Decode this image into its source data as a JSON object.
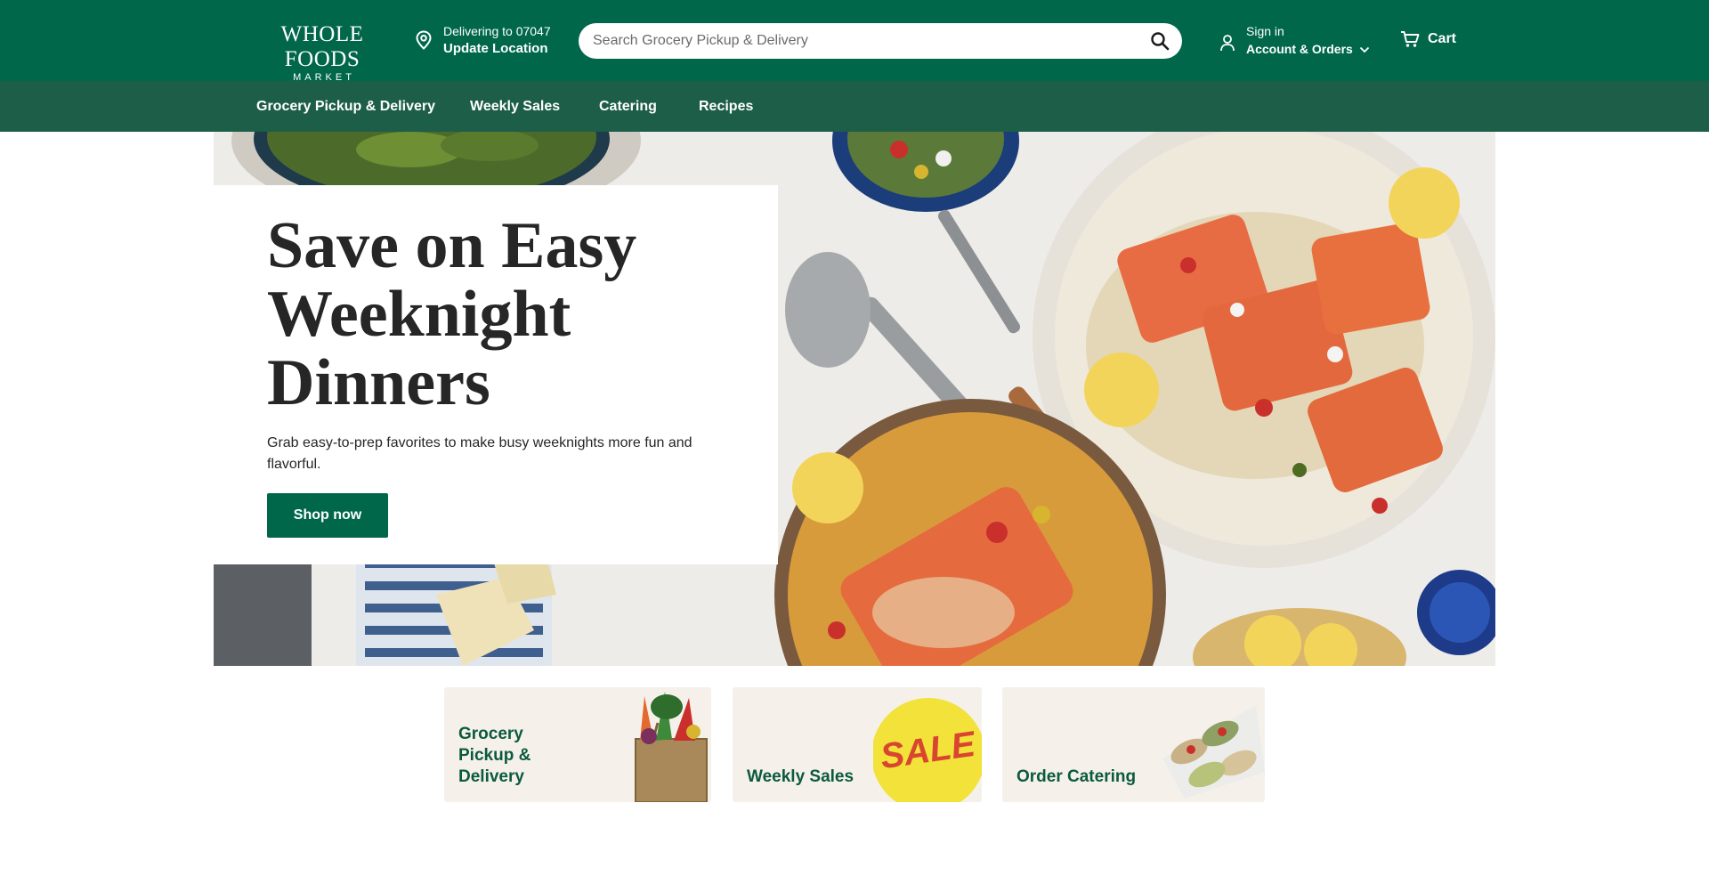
{
  "header": {
    "logo_line1": "WHOLE FOODS",
    "logo_line2": "MARKET",
    "location": {
      "delivering_label": "Delivering to 07047",
      "update_label": "Update Location",
      "icon": "location-pin-icon"
    },
    "search": {
      "placeholder": "Search Grocery Pickup & Delivery",
      "icon": "search-icon"
    },
    "account": {
      "sign_in_label": "Sign in",
      "account_label": "Account & Orders",
      "icon": "person-icon"
    },
    "cart": {
      "label": "Cart",
      "icon": "cart-icon"
    }
  },
  "nav": {
    "items": [
      {
        "label": "Grocery Pickup & Delivery"
      },
      {
        "label": "Weekly Sales"
      },
      {
        "label": "Catering"
      },
      {
        "label": "Recipes"
      }
    ]
  },
  "hero": {
    "title": "Save on Easy Weeknight Dinners",
    "description": "Grab easy-to-prep favorites to make busy weeknights more fun and flavorful.",
    "cta_label": "Shop now"
  },
  "promo_cards": [
    {
      "label": "Grocery Pickup & Delivery"
    },
    {
      "label": "Weekly Sales",
      "badge": "SALE"
    },
    {
      "label": "Order Catering"
    }
  ],
  "colors": {
    "brand_green": "#00674b",
    "nav_green": "#1d5e48",
    "card_bg": "#f5f1ea",
    "sale_yellow": "#f2e23a"
  }
}
